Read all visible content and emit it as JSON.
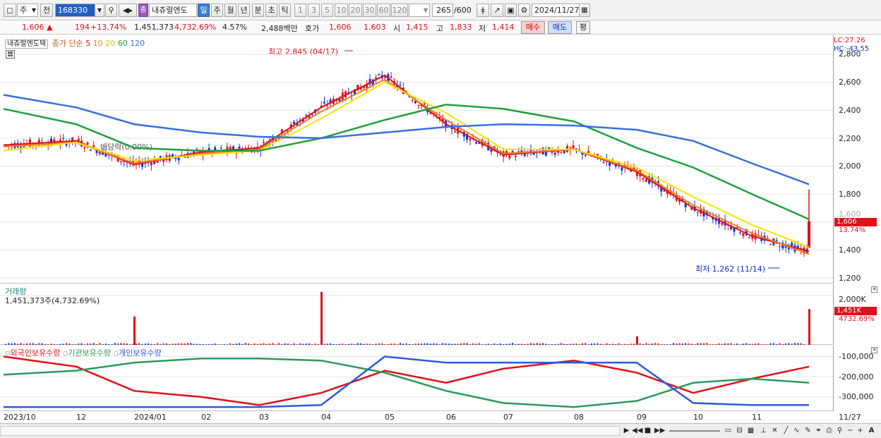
{
  "toolbar": {
    "type_value": "주",
    "jeon_label": "전",
    "code_value": "168330",
    "brand_badge": "종",
    "name_value": "내츄럴엔도",
    "period_buttons": [
      "일",
      "주",
      "월",
      "년",
      "분",
      "초",
      "틱"
    ],
    "interval_buttons": [
      "1",
      "3",
      "5",
      "10",
      "20",
      "30",
      "60",
      "120"
    ],
    "count_value": "265",
    "count_total": "/600",
    "date_value": "2024/11/27"
  },
  "quote": {
    "price": "1,606",
    "change_arrow": "▲",
    "change": "194",
    "change_pct": "+13.74%",
    "volume": "1,451,373",
    "volume_ratio": "4,732.69%",
    "turnover": "4.57%",
    "amount": "2,488백만",
    "hoga_label": "호가",
    "ask": "1,606",
    "bid": "1,603",
    "open_label": "시",
    "open": "1,415",
    "high_label": "고",
    "high": "1,833",
    "low_label": "저",
    "low": "1,414",
    "buy_label": "매수",
    "sell_label": "매도",
    "eval_label": "평"
  },
  "price_panel": {
    "stock_name": "내츄럴엔도텍",
    "legend_prefix": "종가 단순",
    "ma_periods": [
      "5",
      "10",
      "20",
      "60",
      "120"
    ],
    "lc_label": "LC:27.26",
    "hc_label": "HC:-43.55",
    "high_annotation": "최고 2,845 (04/17)",
    "low_annotation": "최저 1,262 (11/14)",
    "dividend_annotation": "배당락(0.00%)",
    "y_ticks": [
      "2,800",
      "2,600",
      "2,400",
      "2,200",
      "2,000",
      "1,800",
      "1,600",
      "1,400",
      "1,200"
    ],
    "last_price_tag": "1,606",
    "last_pct_tag": "13.74%"
  },
  "volume_panel": {
    "title": "거래량",
    "value_label": "1,451,373주(4,732.69%)",
    "y_tick": "2,000K",
    "last_tag": "1,451K",
    "last_pct_tag": "4732.69%"
  },
  "holding_panel": {
    "legends": [
      "외국인보유수량",
      "기관보유수량",
      "개인보유수량"
    ],
    "y_ticks": [
      "-100,000",
      "-200,000",
      "-300,000"
    ]
  },
  "x_axis": {
    "labels": [
      "2023/10",
      "12",
      "2024/01",
      "02",
      "03",
      "04",
      "05",
      "06",
      "07",
      "08",
      "09",
      "10",
      "11"
    ],
    "last_label": "11/27"
  },
  "colors": {
    "candle_up": "#e0101a",
    "candle_down": "#1030d0",
    "ma5": "#e0101a",
    "ma10": "#f08020",
    "ma20": "#f5e600",
    "ma60": "#20a040",
    "ma120": "#3a6ee0",
    "foreign": "#e0101a",
    "institution": "#2a9a5a",
    "individual": "#2a5ae0"
  },
  "chart_data": [
    {
      "type": "line",
      "title": "",
      "ylim": [
        1200,
        2800
      ],
      "series": [
        {
          "name": "5",
          "x": [
            "2023/10",
            "12",
            "2024/01",
            "02",
            "03",
            "04",
            "05",
            "06",
            "07",
            "08",
            "09",
            "10",
            "11",
            "11/27"
          ],
          "values": [
            2150,
            2180,
            2010,
            2100,
            2130,
            2420,
            2650,
            2300,
            2080,
            2120,
            1960,
            1700,
            1500,
            1390
          ]
        },
        {
          "name": "10",
          "x": [
            "2023/10",
            "12",
            "2024/01",
            "02",
            "03",
            "04",
            "05",
            "06",
            "07",
            "08",
            "09",
            "10",
            "11",
            "11/27"
          ],
          "values": [
            2140,
            2170,
            2020,
            2090,
            2120,
            2390,
            2620,
            2330,
            2090,
            2120,
            1970,
            1720,
            1520,
            1370
          ]
        },
        {
          "name": "20",
          "x": [
            "2023/10",
            "12",
            "2024/01",
            "02",
            "03",
            "04",
            "05",
            "06",
            "07",
            "08",
            "09",
            "10",
            "11",
            "11/27"
          ],
          "values": [
            2110,
            2170,
            2040,
            2080,
            2110,
            2340,
            2600,
            2380,
            2120,
            2120,
            1990,
            1780,
            1580,
            1420
          ]
        },
        {
          "name": "60",
          "x": [
            "2023/10",
            "12",
            "2024/01",
            "02",
            "03",
            "04",
            "05",
            "06",
            "07",
            "08",
            "09",
            "10",
            "11",
            "11/27"
          ],
          "values": [
            2410,
            2300,
            2130,
            2110,
            2110,
            2200,
            2330,
            2440,
            2410,
            2320,
            2130,
            1990,
            1800,
            1620
          ]
        },
        {
          "name": "120",
          "x": [
            "2023/10",
            "12",
            "2024/01",
            "02",
            "03",
            "04",
            "05",
            "06",
            "07",
            "08",
            "09",
            "10",
            "11",
            "11/27"
          ],
          "values": [
            2510,
            2420,
            2300,
            2240,
            2210,
            2200,
            2240,
            2280,
            2300,
            2290,
            2260,
            2180,
            2020,
            1870
          ]
        }
      ],
      "annotations": [
        "최고 2,845 (04/17)",
        "최저 1,262 (11/14)"
      ]
    },
    {
      "type": "bar",
      "title": "거래량",
      "y_unit": "K",
      "ylim": [
        0,
        2000
      ],
      "categories": [
        "2023/10",
        "12",
        "2024/01",
        "02",
        "03",
        "04",
        "05",
        "06",
        "07",
        "08",
        "09",
        "10",
        "11",
        "11/27"
      ],
      "values": [
        30,
        40,
        1150,
        60,
        50,
        2150,
        160,
        50,
        60,
        40,
        350,
        40,
        50,
        1451
      ]
    },
    {
      "type": "line",
      "title": "",
      "ylim": [
        -360000,
        -60000
      ],
      "categories": [
        "2023/10",
        "12",
        "2024/01",
        "02",
        "03",
        "04",
        "05",
        "06",
        "07",
        "08",
        "09",
        "10",
        "11",
        "11/27"
      ],
      "series": [
        {
          "name": "외국인보유수량",
          "values": [
            -100000,
            -150000,
            -270000,
            -300000,
            -340000,
            -280000,
            -170000,
            -230000,
            -160000,
            -120000,
            -180000,
            -280000,
            -210000,
            -150000
          ]
        },
        {
          "name": "기관보유수량",
          "values": [
            -190000,
            -170000,
            -130000,
            -110000,
            -110000,
            -120000,
            -180000,
            -270000,
            -330000,
            -350000,
            -320000,
            -230000,
            -210000,
            -230000
          ]
        },
        {
          "name": "개인보유수량",
          "values": [
            -350000,
            -350000,
            -350000,
            -350000,
            -350000,
            -340000,
            -100000,
            -130000,
            -130000,
            -130000,
            -130000,
            -330000,
            -340000,
            -340000
          ]
        }
      ]
    }
  ]
}
